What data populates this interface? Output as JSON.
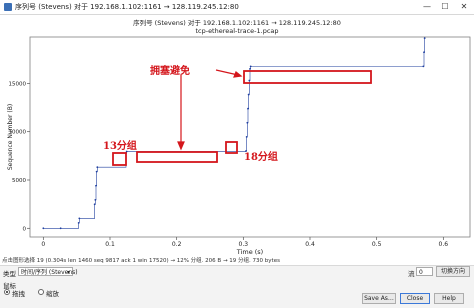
{
  "window": {
    "title": "序列号 (Stevens) 对于 192.168.1.102:1161 → 128.119.245.12:80",
    "minimize": "—",
    "maximize": "☐",
    "close": "✕"
  },
  "chart_data": {
    "type": "scatter",
    "title": "序列号 (Stevens) 对于 192.168.1.102:1161 → 128.119.245.12:80",
    "subtitle": "tcp-ethereal-trace-1.pcap",
    "xlabel": "Time (s)",
    "ylabel": "Sequence Number (B)",
    "xlim": [
      -0.02,
      0.64
    ],
    "ylim": [
      -900,
      19800
    ],
    "xticks": [
      0,
      0.1,
      0.2,
      0.3,
      0.4,
      0.5,
      0.6
    ],
    "xtick_labels": [
      "0",
      "0.1",
      "0.2",
      "0.3",
      "0.4",
      "0.5",
      "0.6"
    ],
    "yticks": [
      0,
      5000,
      10000,
      15000
    ],
    "ytick_labels": [
      "0",
      "5000",
      "10000",
      "15000"
    ],
    "points": [
      {
        "x": 0.0,
        "y": 0
      },
      {
        "x": 0.026,
        "y": 0
      },
      {
        "x": 0.053,
        "y": 565
      },
      {
        "x": 0.054,
        "y": 1025
      },
      {
        "x": 0.077,
        "y": 2485
      },
      {
        "x": 0.078,
        "y": 2945
      },
      {
        "x": 0.079,
        "y": 4405
      },
      {
        "x": 0.08,
        "y": 5865
      },
      {
        "x": 0.081,
        "y": 6325
      },
      {
        "x": 0.124,
        "y": 7785
      },
      {
        "x": 0.125,
        "y": 7945
      },
      {
        "x": 0.304,
        "y": 8000
      },
      {
        "x": 0.305,
        "y": 9460
      },
      {
        "x": 0.306,
        "y": 10920
      },
      {
        "x": 0.307,
        "y": 12380
      },
      {
        "x": 0.308,
        "y": 13840
      },
      {
        "x": 0.309,
        "y": 15300
      },
      {
        "x": 0.31,
        "y": 16500
      },
      {
        "x": 0.311,
        "y": 16760
      },
      {
        "x": 0.57,
        "y": 16760
      },
      {
        "x": 0.571,
        "y": 18220
      },
      {
        "x": 0.572,
        "y": 19680
      }
    ],
    "grid": false,
    "color": "#1f3f9f"
  },
  "annotations": {
    "congestion_avoidance": "拥塞避免",
    "segments_13": "13分组",
    "segments_18": "18分组",
    "color": "#d4161c"
  },
  "status": "点击图形选择 19 (0.304s len 1460 seq 9817 ack 1 win 17520) → 12% 分组. 206 B → 19 分组. 730 bytes",
  "controls": {
    "type_label": "类型",
    "type_value": "时间/序列 (Stevens)",
    "stream_label": "流",
    "stream_value": "0",
    "switch_direction": "切换方向",
    "mouse_label": "鼠标",
    "drag_label": "拖拽",
    "zoom_label": "缩放",
    "save_as": "Save As…",
    "close": "Close",
    "help": "Help"
  }
}
